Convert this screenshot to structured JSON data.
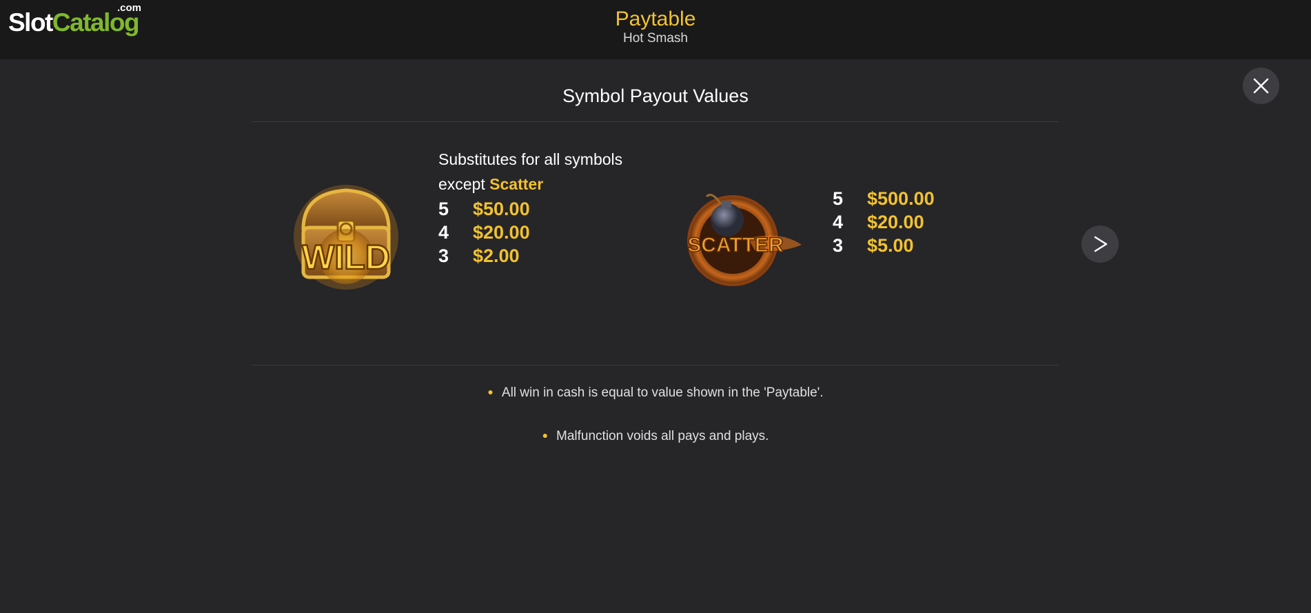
{
  "header": {
    "logo": {
      "slot": "Slot",
      "catalog": "Catalog",
      "com": ".com"
    },
    "title": "Paytable",
    "subtitle": "Hot Smash"
  },
  "controls": {
    "close_icon": "close-icon",
    "next_icon": "chevron-right-icon"
  },
  "section": {
    "title": "Symbol Payout Values"
  },
  "symbols": [
    {
      "name": "WILD",
      "description_line1": "Substitutes for all symbols",
      "description_prefix": "except",
      "description_highlight": "Scatter",
      "pays": [
        {
          "count": "5",
          "value": "$50.00"
        },
        {
          "count": "4",
          "value": "$20.00"
        },
        {
          "count": "3",
          "value": "$2.00"
        }
      ]
    },
    {
      "name": "SCATTER",
      "pays": [
        {
          "count": "5",
          "value": "$500.00"
        },
        {
          "count": "4",
          "value": "$20.00"
        },
        {
          "count": "3",
          "value": "$5.00"
        }
      ]
    }
  ],
  "notes": [
    "All win in cash is equal to value shown in the 'Paytable'.",
    "Malfunction voids all pays and plays."
  ],
  "colors": {
    "accent": "#f2c230",
    "logo_green": "#7fb82d",
    "background": "#262528",
    "header_bg": "#19191a"
  }
}
